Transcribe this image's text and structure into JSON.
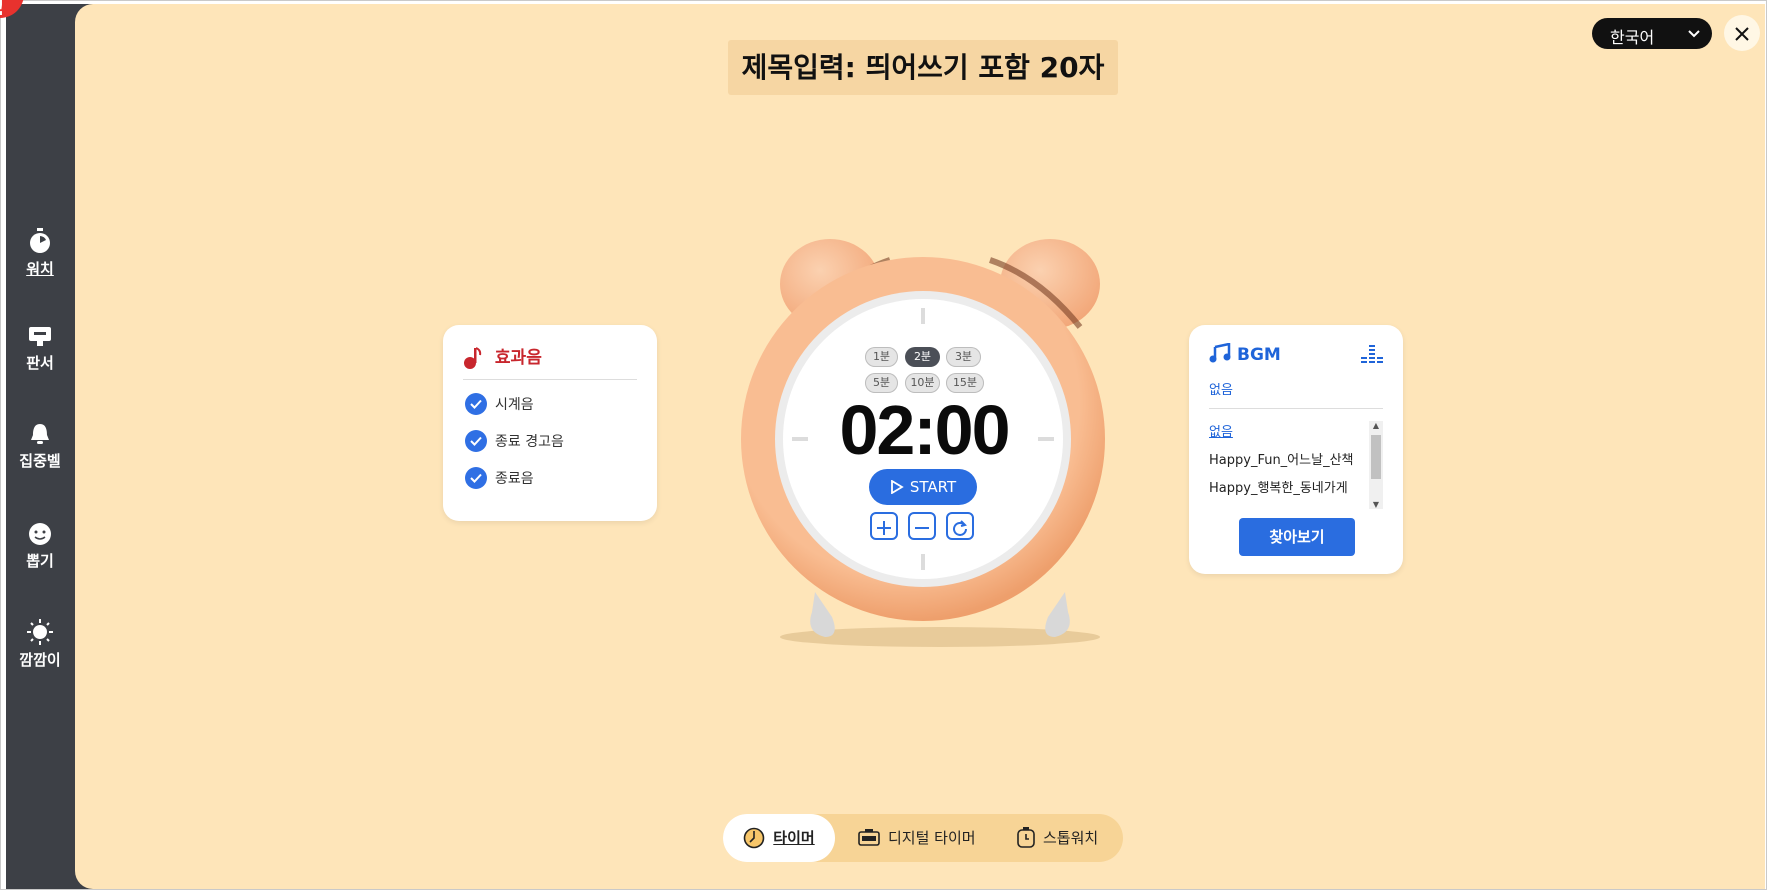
{
  "sidebar": {
    "items": [
      {
        "label": "워치",
        "icon": "stopwatch-icon",
        "active": true
      },
      {
        "label": "판서",
        "icon": "board-icon"
      },
      {
        "label": "집중벨",
        "icon": "bell-icon"
      },
      {
        "label": "뽑기",
        "icon": "face-icon"
      },
      {
        "label": "깜깜이",
        "icon": "sun-icon"
      }
    ]
  },
  "header": {
    "title": "제목입력: 띄어쓰기 포함 20자"
  },
  "language": {
    "selected": "한국어"
  },
  "effects": {
    "title": "효과음",
    "options": [
      {
        "label": "시계음",
        "checked": true
      },
      {
        "label": "종료 경고음",
        "checked": true
      },
      {
        "label": "종료음",
        "checked": true
      }
    ]
  },
  "timer": {
    "presets": [
      "1분",
      "2분",
      "3분",
      "5분",
      "10분",
      "15분"
    ],
    "selected_preset": "2분",
    "time": "02:00",
    "start_label": "START"
  },
  "bgm": {
    "title": "BGM",
    "current": "없음",
    "tracks": [
      "없음",
      "Happy_Fun_어느날_산책",
      "Happy_행복한_동네가게"
    ],
    "browse_label": "찾아보기"
  },
  "modes": [
    {
      "label": "타이머",
      "icon": "clock-icon",
      "active": true
    },
    {
      "label": "디지털 타이머",
      "icon": "digital-clock-icon"
    },
    {
      "label": "스톱워치",
      "icon": "stopwatch-icon"
    }
  ],
  "colors": {
    "background": "#fee5b9",
    "sidebar": "#3d4046",
    "accent": "#2a6de0",
    "effects_red": "#c8262d",
    "clock_body": "#f7b184"
  }
}
